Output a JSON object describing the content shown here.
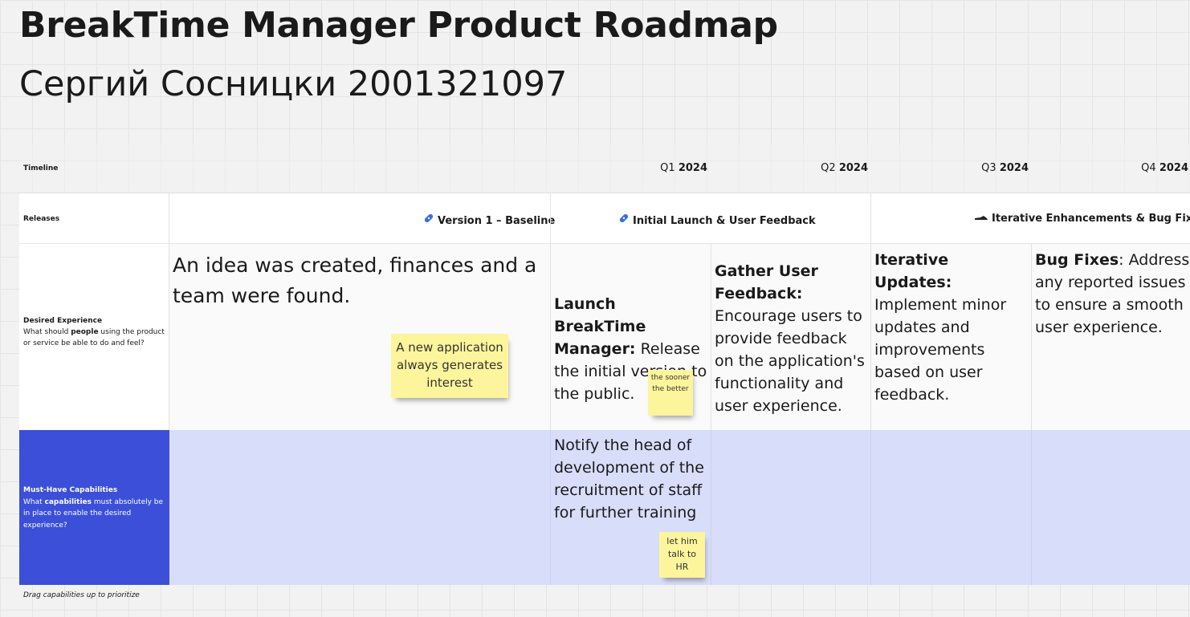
{
  "title": "BreakTime Manager Product Roadmap",
  "author": "Сергий Сосницки 2001321097",
  "rows": {
    "timeline": "Timeline",
    "releases": "Releases",
    "desired": {
      "title": "Desired Experience",
      "q_pre": "What should ",
      "q_bold": "people",
      "q_post": " using the product or service be able to do and feel?"
    },
    "must": {
      "title": "Must-Have Capabilities",
      "q_pre": "What ",
      "q_bold": "capabilities",
      "q_post": " must absolutely be in place to enable the desired experience?"
    }
  },
  "timeline": [
    {
      "q": "Q1",
      "year": "2024"
    },
    {
      "q": "Q2",
      "year": "2024"
    },
    {
      "q": "Q3",
      "year": "2024"
    },
    {
      "q": "Q4",
      "year": "2024"
    }
  ],
  "releases": [
    {
      "label": "Version 1 – Baseline",
      "icon": "pin-icon"
    },
    {
      "label": "Initial Launch & User Feedback",
      "icon": "pin-icon"
    },
    {
      "label": "Iterative Enhancements & Bug Fixes",
      "icon": "sneaker-icon"
    }
  ],
  "desired_cells": {
    "baseline": "An idea was created, finances and a team were found.",
    "launch_bold": "Launch BreakTime Manager:",
    "launch_text": " Release the initial version to the public.",
    "feedback_bold": "Gather User Feedback:",
    "feedback_text": " Encourage users to provide feedback on the application's functionality and user experience.",
    "updates_bold": "Iterative Updates:",
    "updates_text": " Implement minor updates and improvements based on user feedback.",
    "bugs_bold": "Bug Fixes",
    "bugs_text": ": Address any reported issues to ensure a smooth user experience."
  },
  "must_cells": {
    "launch": "Notify the head of development of the recruitment of staff for further training"
  },
  "stickies": {
    "interest": "A new application always generates interest",
    "sooner": "the sooner the better",
    "hr": "let him talk to HR"
  },
  "hint": "Drag capabilities up to prioritize",
  "colors": {
    "must_label_bg": "#3b4fd8",
    "must_row_bg": "#d8ddfa",
    "sticky": "#fdf59c"
  }
}
